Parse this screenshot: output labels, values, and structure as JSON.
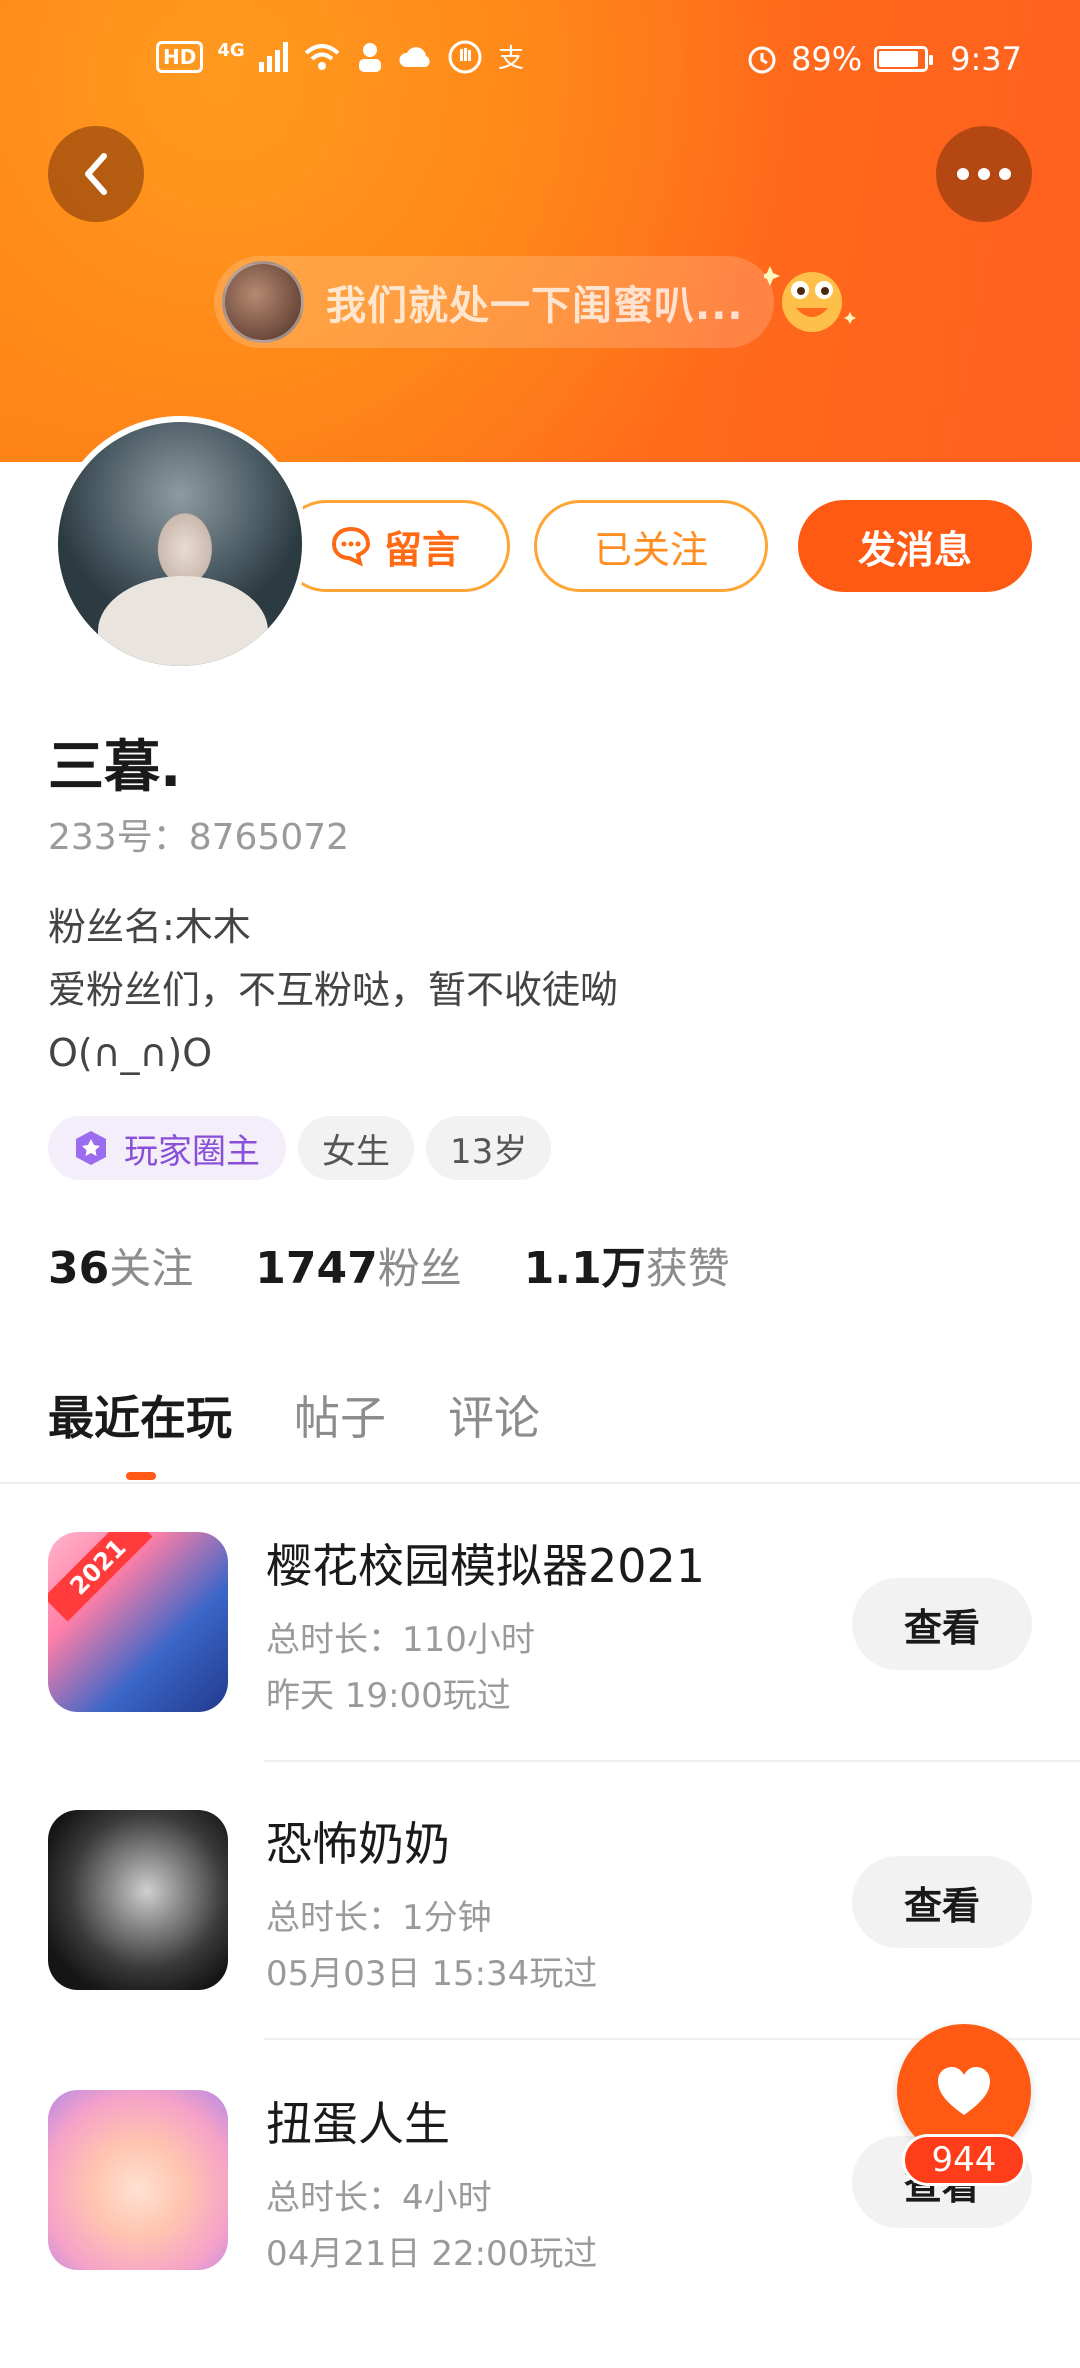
{
  "status_bar": {
    "hd": "HD",
    "network": "4G",
    "battery_percent": "89%",
    "time": "9:37"
  },
  "header": {
    "message_preview": "我们就处一下闺蜜叭...",
    "brand_color": "#ff6e1a"
  },
  "actions": {
    "leave_message": "留言",
    "follow": "已关注",
    "send_message": "发消息"
  },
  "profile": {
    "name": "三暮.",
    "uid": "233号：8765072",
    "bio": "粉丝名:木木\n爱粉丝们，不互粉哒，暂不收徒呦\nO(∩_∩)O",
    "tags": [
      "玩家圈主",
      "女生",
      "13岁"
    ]
  },
  "stats": [
    {
      "value": "36",
      "label": "关注"
    },
    {
      "value": "1747",
      "label": "粉丝"
    },
    {
      "value": "1.1万",
      "label": "获赞"
    }
  ],
  "tabs": [
    "最近在玩",
    "帖子",
    "评论"
  ],
  "games": [
    {
      "title": "樱花校园模拟器2021",
      "duration": "总时长：110小时",
      "last_played": "昨天 19:00玩过",
      "badge": "2021",
      "view_label": "查看"
    },
    {
      "title": "恐怖奶奶",
      "duration": "总时长：1分钟",
      "last_played": "05月03日 15:34玩过",
      "view_label": "查看"
    },
    {
      "title": "扭蛋人生",
      "duration": "总时长：4小时",
      "last_played": "04月21日 22:00玩过",
      "view_label": "查看"
    }
  ],
  "like_count": "944"
}
